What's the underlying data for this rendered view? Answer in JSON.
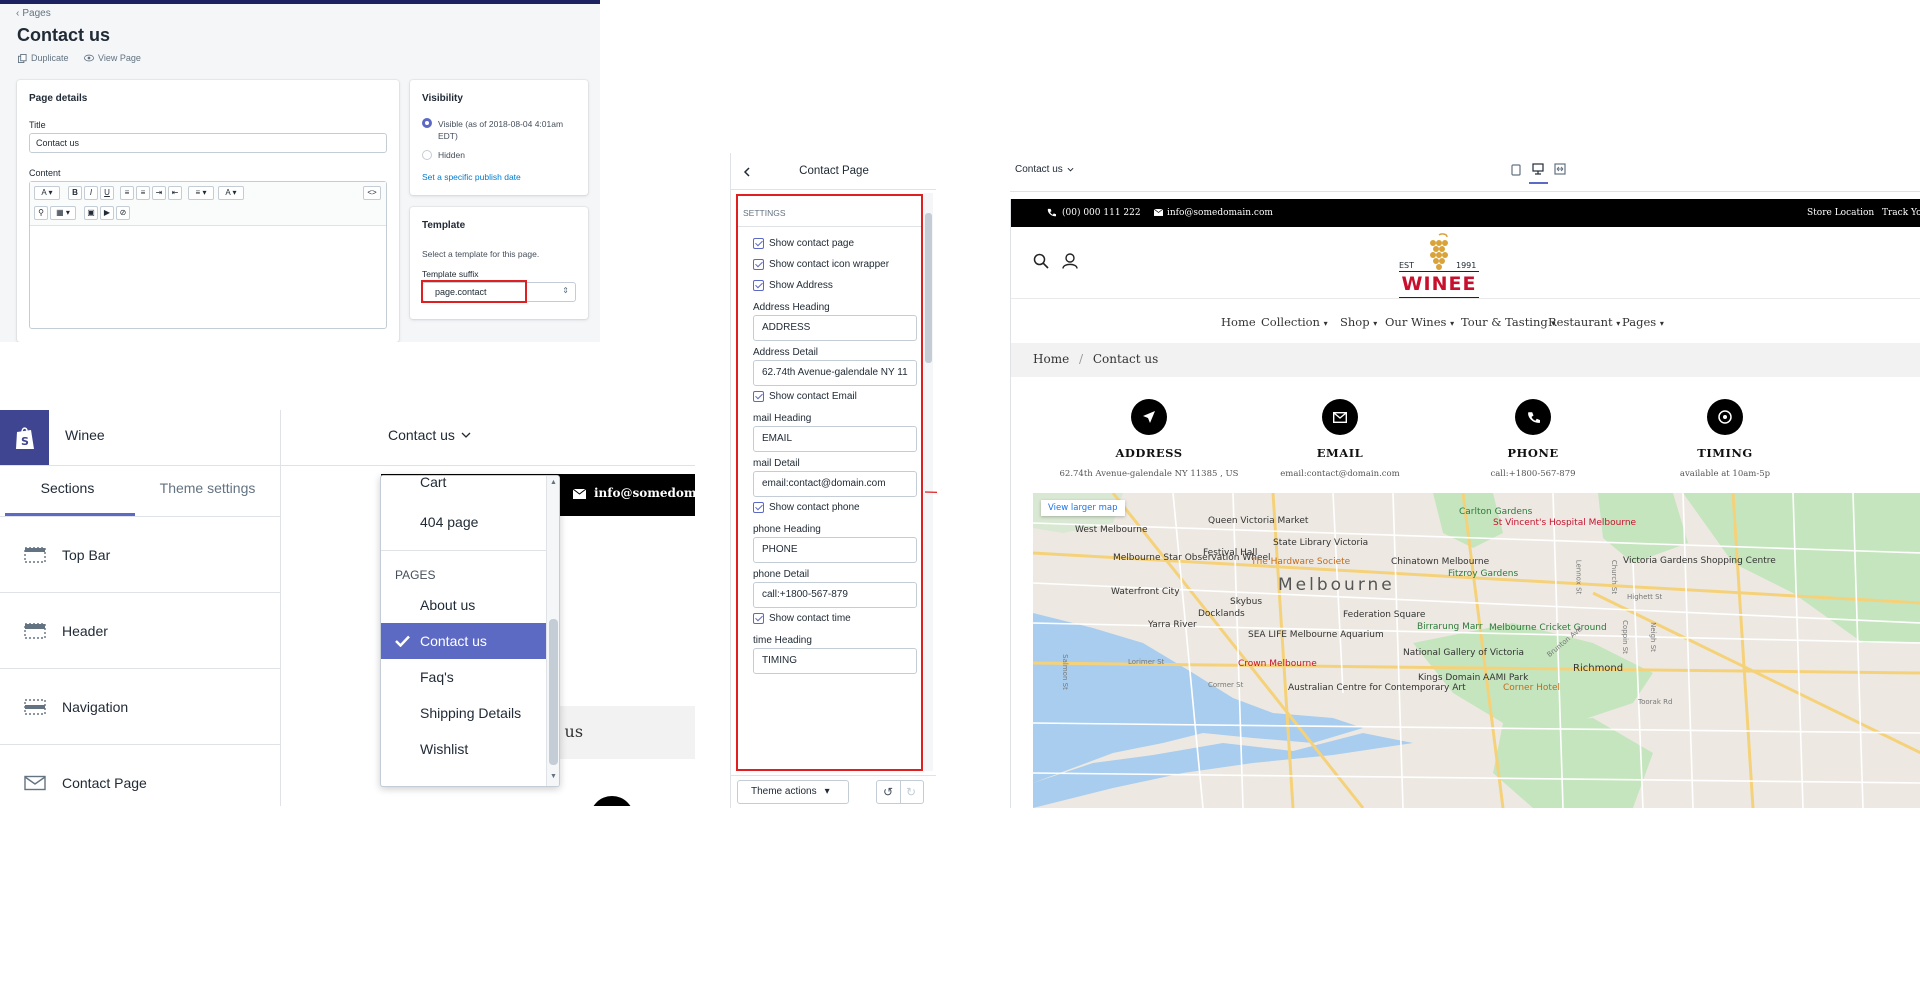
{
  "page_editor": {
    "breadcrumb": "Pages",
    "title": "Contact us",
    "actions": {
      "duplicate": "Duplicate",
      "view_page": "View Page"
    },
    "details": {
      "heading": "Page details",
      "title_label": "Title",
      "title_value": "Contact us",
      "content_label": "Content",
      "toolbar": [
        "A",
        "B",
        "I",
        "U",
        "",
        "",
        "",
        "",
        "",
        "A",
        "<>"
      ]
    },
    "visibility": {
      "heading": "Visibility",
      "visible_label": "Visible (as of 2018-08-04 4:01am EDT)",
      "hidden_label": "Hidden",
      "publish_link": "Set a specific publish date"
    },
    "template": {
      "heading": "Template",
      "help": "Select a template for this page.",
      "suffix_label": "Template suffix",
      "suffix_value": "page.contact"
    }
  },
  "theme_editor": {
    "store_name": "Winee",
    "page_selector": "Contact us",
    "tabs": [
      "Sections",
      "Theme settings"
    ],
    "sections": [
      "Top Bar",
      "Header",
      "Navigation",
      "Contact Page"
    ],
    "preview_email": "info@somedomain",
    "preview_heading_fragment": "t us",
    "dropdown": {
      "items_top": [
        "Cart",
        "404 page"
      ],
      "group_label": "PAGES",
      "items": [
        "About us",
        "Contact us",
        "Faq's",
        "Shipping Details",
        "Wishlist"
      ],
      "selected": "Contact us"
    }
  },
  "settings_panel": {
    "title": "Contact Page",
    "section_label": "SETTINGS",
    "show_contact_page": "Show contact page",
    "show_icon_wrapper": "Show contact icon wrapper",
    "show_address": "Show Address",
    "address_heading_label": "Address Heading",
    "address_heading_value": "ADDRESS",
    "address_detail_label": "Address Detail",
    "address_detail_value": "62.74th Avenue-galendale NY 11",
    "show_email": "Show contact Email",
    "mail_heading_label": "mail Heading",
    "mail_heading_value": "EMAIL",
    "mail_detail_label": "mail Detail",
    "mail_detail_value": "email:contact@domain.com",
    "show_phone": "Show contact phone",
    "phone_heading_label": "phone Heading",
    "phone_heading_value": "PHONE",
    "phone_detail_label": "phone Detail",
    "phone_detail_value": "call:+1800-567-879",
    "show_time": "Show contact time",
    "time_heading_label": "time Heading",
    "time_heading_value": "TIMING",
    "theme_actions": "Theme actions"
  },
  "preview": {
    "page_selector": "Contact us",
    "topbar": {
      "phone": "(00) 000 111 222",
      "email": "info@somedomain.com",
      "store_location": "Store Location",
      "track": "Track Yo"
    },
    "logo": {
      "est": "EST",
      "year": "1991",
      "brand": "WINEE"
    },
    "nav": [
      "Home",
      "Collection",
      "Shop",
      "Our Wines",
      "Tour & Tasting",
      "Restaurant",
      "Pages"
    ],
    "breadcrumb": {
      "home": "Home",
      "sep": "/",
      "current": "Contact us"
    },
    "features": [
      {
        "heading": "ADDRESS",
        "detail": "62.74th Avenue-galendale NY 11385 , US"
      },
      {
        "heading": "EMAIL",
        "detail": "email:contact@domain.com"
      },
      {
        "heading": "PHONE",
        "detail": "call:+1800-567-879"
      },
      {
        "heading": "TIMING",
        "detail": "available at 10am-5p"
      }
    ],
    "map": {
      "larger_map": "View larger map",
      "city": "Melbourne",
      "labels": [
        "West Melbourne",
        "Queen Victoria Market",
        "State Library Victoria",
        "Carlton Gardens",
        "St Vincent's Hospital Melbourne",
        "Melbourne Star Observation Wheel",
        "Festival Hall",
        "The Hardware Societe",
        "Chinatown Melbourne",
        "Fitzroy Gardens",
        "Victoria Gardens Shopping Centre",
        "Waterfront City",
        "Skybus",
        "Docklands",
        "Federation Square",
        "Birrarung Marr",
        "Melbourne Cricket Ground",
        "Yarra River",
        "SEA LIFE Melbourne Aquarium",
        "National Gallery of Victoria",
        "Crown Melbourne",
        "Kings Domain",
        "AAMI Park",
        "Richmond",
        "Australian Centre for Contemporary Art",
        "Corner Hotel",
        "Lorimer St",
        "Cormer St",
        "Salmon St",
        "Brunton Ave",
        "Lennox St",
        "Church St",
        "Highett St",
        "Coppin St",
        "Neigh St",
        "Toorak Rd"
      ]
    }
  }
}
